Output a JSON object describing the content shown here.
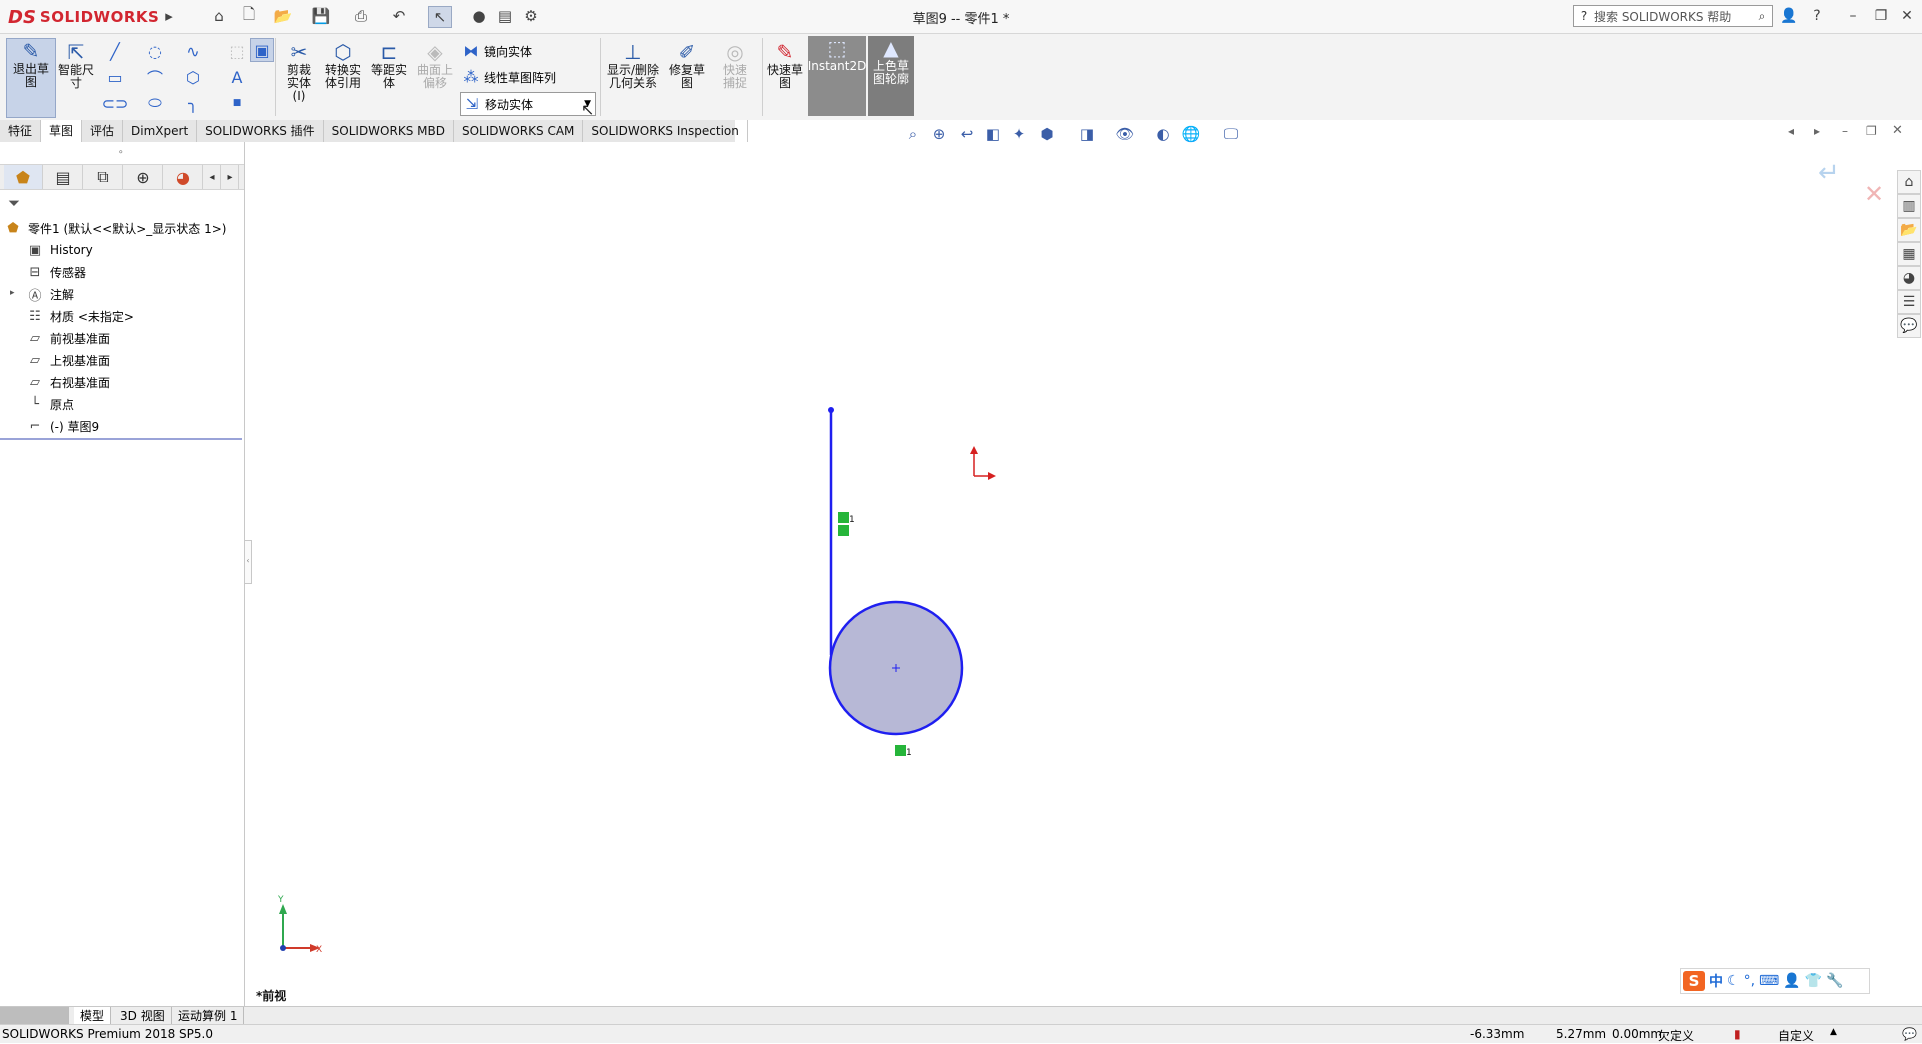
{
  "app": {
    "logo_prefix": "DS",
    "logo_name": "SOLIDWORKS",
    "document_title": "草图9 -- 零件1 *",
    "search_placeholder": "搜索 SOLIDWORKS 帮助"
  },
  "ribbon": {
    "exit_sketch": "退出草图",
    "smart_dimension": "智能尺寸",
    "trim": "剪裁实体(I)",
    "convert": "转换实体引用",
    "offset": "等距实体",
    "surface_offset": "曲面上偏移",
    "mirror": "镜向实体",
    "linear_pattern": "线性草图阵列",
    "move": "移动实体",
    "display_relations": "显示/删除几何关系",
    "repair": "修复草图",
    "quick_snaps": "快速捕捉",
    "rapid_sketch": "快速草图",
    "instant2d": "Instant2D",
    "shaded_contours": "上色草图轮廓"
  },
  "tabs": [
    "特征",
    "草图",
    "评估",
    "DimXpert",
    "SOLIDWORKS 插件",
    "SOLIDWORKS MBD",
    "SOLIDWORKS CAM",
    "SOLIDWORKS Inspection"
  ],
  "tree": {
    "root": "零件1 (默认<<默认>_显示状态 1>)",
    "items": [
      "History",
      "传感器",
      "注解",
      "材质 <未指定>",
      "前视基准面",
      "上视基准面",
      "右视基准面",
      "原点",
      "(-) 草图9"
    ]
  },
  "viewport": {
    "view_name": "*前视",
    "relation_badge_1": "1",
    "relation_badge_2": "1",
    "triad_x": "X",
    "triad_y": "Y"
  },
  "bottom_tabs": [
    "模型",
    "3D 视图",
    "运动算例 1"
  ],
  "status": {
    "product": "SOLIDWORKS Premium 2018 SP5.0",
    "x": "-6.33mm",
    "y": "5.27mm",
    "z": "0.00mm",
    "state": "欠定义",
    "units": "自定义"
  },
  "ime": {
    "logo": "S",
    "mode": "中"
  }
}
